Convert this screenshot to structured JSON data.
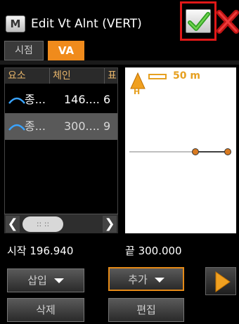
{
  "window": {
    "title": "Edit Vt Alnt (VERT)",
    "app_icon_letter": "M"
  },
  "tabs": [
    {
      "label": "시점",
      "active": false
    },
    {
      "label": "VA",
      "active": true
    }
  ],
  "table": {
    "columns": [
      "요소",
      "체인",
      "표"
    ],
    "rows": [
      {
        "element": "종...",
        "chain": "146....",
        "extra": "6",
        "selected": false
      },
      {
        "element": "종...",
        "chain": "300....",
        "extra": "9",
        "selected": true
      }
    ]
  },
  "map": {
    "scale_label": "50 m",
    "north_marker": "H"
  },
  "range": {
    "start_label": "시작 196.940",
    "end_label": "끝 300.000"
  },
  "buttons": {
    "insert": "삽입",
    "add": "추가",
    "delete": "삭제",
    "edit": "편집"
  },
  "colors": {
    "accent": "#f08b1c",
    "confirm": "#3fae2c",
    "cancel": "#d62020",
    "selection": "#595959"
  },
  "icons": {
    "app": "app-m-icon",
    "confirm": "checkmark-icon",
    "cancel": "close-x-icon",
    "next": "play-right-icon"
  }
}
